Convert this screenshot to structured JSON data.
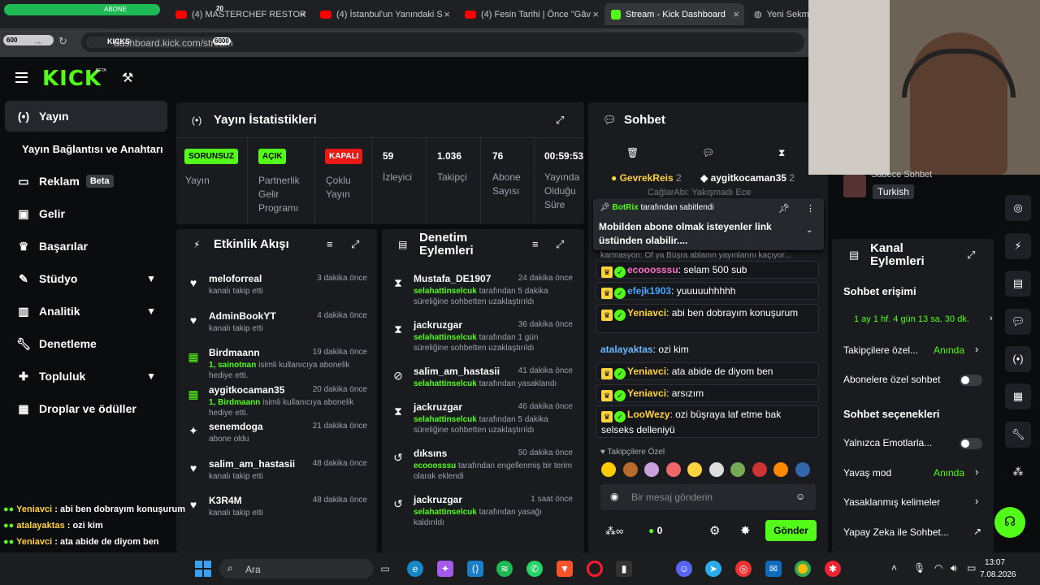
{
  "browser": {
    "tabs": [
      {
        "label": "",
        "badge": "ABONE"
      },
      {
        "label": "(4) MASTERCHEF RESTORA"
      },
      {
        "label": "(4) İstanbul'un Yanındaki S"
      },
      {
        "label": "(4) Fesin Tarihi | Önce \"Gâv"
      },
      {
        "label": "Stream - Kick Dashboard"
      },
      {
        "label": "Yeni Sekme"
      }
    ],
    "url": "dashboard.kick.com/stream",
    "overlay_top": "KICKS",
    "overlay_600": "600",
    "overlay_6000": "6000",
    "overlay_20": "20"
  },
  "kick": {
    "logo": "KICK",
    "logo_tag": "BETA"
  },
  "sidebar": {
    "items": [
      {
        "label": "Yayın",
        "icon": "broadcast-icon"
      },
      {
        "label": "Yayın Bağlantısı ve Anahtarı"
      },
      {
        "label": "Reklam",
        "icon": "ad-icon",
        "badge": "Beta"
      },
      {
        "label": "Gelir",
        "icon": "wallet-icon"
      },
      {
        "label": "Başarılar",
        "icon": "trophy-icon"
      },
      {
        "label": "Stüdyo",
        "icon": "brush-icon"
      },
      {
        "label": "Analitik",
        "icon": "chart-icon"
      },
      {
        "label": "Denetleme",
        "icon": "wrench-icon"
      },
      {
        "label": "Topluluk",
        "icon": "community-icon"
      },
      {
        "label": "Droplar ve ödüller",
        "icon": "gift-icon"
      }
    ]
  },
  "stats": {
    "title": "Yayın İstatistikleri",
    "cols": [
      {
        "badge": "SORUNSUZ",
        "label": "Yayın"
      },
      {
        "badge": "AÇIK",
        "label": "Partnerlik Gelir Programı"
      },
      {
        "badge": "KAPALI",
        "label": "Çoklu Yayın"
      },
      {
        "value": "59",
        "label": "İzleyici"
      },
      {
        "value": "1.036",
        "label": "Takipçi"
      },
      {
        "value": "76",
        "label": "Abone Sayısı"
      },
      {
        "value": "00:59:53",
        "label": "Yayında Olduğu Süre"
      }
    ]
  },
  "activity": {
    "title": "Etkinlik Akışı",
    "items": [
      {
        "name": "meloforreal",
        "sub": "kanalı takip etti",
        "time": "3 dakika önce"
      },
      {
        "name": "AdminBookYT",
        "sub": "kanalı takip etti",
        "time": "4 dakika önce"
      },
      {
        "name": "Birdmaann",
        "hl": "1, sainotnan",
        "sub": " isimli kullanıcıya abonelik hediye etti.",
        "time": "19 dakika önce"
      },
      {
        "name": "aygitkocaman35",
        "hl": "1, Birdmaann",
        "sub": " isimli kullanıcıya abonelik hediye etti.",
        "time": "20 dakika önce"
      },
      {
        "name": "senemdoga",
        "sub": "abone oldu",
        "time": "21 dakika önce"
      },
      {
        "name": "salim_am_hastasii",
        "sub": "kanalı takip etti",
        "time": "48 dakika önce"
      },
      {
        "name": "K3R4M",
        "sub": "kanalı takip etti",
        "time": "48 dakika önce"
      }
    ]
  },
  "moderation": {
    "title": "Denetim Eylemleri",
    "items": [
      {
        "name": "Mustafa_DE1907",
        "hl": "selahattinselcuk",
        "sub": " tarafından 5 dakika süreliğine sohbetten uzaklaştırıldı",
        "time": "24 dakika önce"
      },
      {
        "name": "jackruzgar",
        "hl": "selahattinselcuk",
        "sub": " tarafından 1 gün süreliğine sohbetten uzaklaştırıldı",
        "time": "36 dakika önce"
      },
      {
        "name": "salim_am_hastasii",
        "hl": "selahattinselcuk",
        "sub": " tarafından yasaklandı",
        "time": "41 dakika önce"
      },
      {
        "name": "jackruzgar",
        "hl": "selahattinselcuk",
        "sub": " tarafından 5 dakika süreliğine sohbetten uzaklaştırıldı",
        "time": "46 dakika önce"
      },
      {
        "name": "dıksıns",
        "hl": "ecooosssu",
        "sub": " tarafından engellenmiş bir terim olarak eklendi",
        "time": "50 dakika önce"
      },
      {
        "name": "jackruzgar",
        "hl": "selahattinselcuk",
        "sub": " tarafından yasağı kaldırıldı",
        "time": "1 saat önce"
      }
    ]
  },
  "chat": {
    "title": "Sohbet",
    "top_users": [
      {
        "name": "GevrekReis",
        "count": "2"
      },
      {
        "name": "aygitkocaman35",
        "count": "2"
      }
    ],
    "behind": "CağlarAbi: Yakışmadı Ece",
    "pinned_by": "BotRix",
    "pinned_suffix": " tarafından sabitlendi",
    "pinned_msg": "Mobilden abone olmak isteyenler link üstünden olabilir....",
    "reply_hint": "karmasyon: Of ya Büşra ablanın yayınlarını kaçıyor...",
    "messages": [
      {
        "user": "ecooosssu",
        "color": "#ff6ec7",
        "text": " selam 500 sub"
      },
      {
        "user": "efejk1903",
        "color": "#4aa3ff",
        "text": " yuuuuuhhhhh"
      },
      {
        "user": "Yeniavci",
        "color": "#ffd23f",
        "text": " abi ben dobrayım konuşurum"
      },
      {
        "user": "atalayaktas",
        "color": "#6ab7ff",
        "text": " ozi kim"
      },
      {
        "user": "Yeniavci",
        "color": "#ffd23f",
        "text": " ata abide de diyom ben"
      },
      {
        "user": "Yeniavci",
        "color": "#ffd23f",
        "text": " arsızım"
      },
      {
        "user": "LooWezy",
        "color": "#ffd23f",
        "text": " ozi büşraya laf etme bak selseks delleniyü"
      }
    ],
    "emote_label": "Takipçilere Özel",
    "input_placeholder": "Bir mesaj gönderin",
    "send": "Gönder",
    "kicks_count": "0"
  },
  "right_panel": {
    "sadece": "Sadece Sohbet",
    "lang": "Turkish",
    "title": "Kanal Eylemleri",
    "access_title": "Sohbet erişimi",
    "access_value": "1 ay 1 hf. 4 gün 13 sa. 30 dk.",
    "followers_only": "Takipçilere özel...",
    "followers_only_val": "Anında",
    "subs_only": "Abonelere özel sohbet",
    "options_title": "Sohbet seçenekleri",
    "emote_only": "Yalnızca Emotlarla...",
    "slow_mode": "Yavaş mod",
    "slow_mode_val": "Anında",
    "banned_words": "Yasaklanmış kelimeler",
    "ai": "Yapay Zeka ile Sohbet..."
  },
  "overlay": {
    "lines": [
      {
        "user": "Yeniavci",
        "text": " : abi ben dobrayım konuşurum"
      },
      {
        "user": "atalayaktas",
        "text": " : ozi kim"
      },
      {
        "user": "Yeniavci",
        "text": " : ata abide de diyom ben"
      },
      {
        "user": "Yeniavci",
        "text": " : arsızım"
      },
      {
        "user": "LooWezy",
        "text": " : ozi büşraya laf etme bak selseks delleniyü"
      }
    ]
  },
  "taskbar": {
    "search": "Ara",
    "time": "13:07",
    "date": "7.08.2026"
  },
  "colors": {
    "accent": "#53fc18",
    "panel": "#191b1f",
    "bg": "#0b0c0e",
    "red": "#e91916"
  }
}
